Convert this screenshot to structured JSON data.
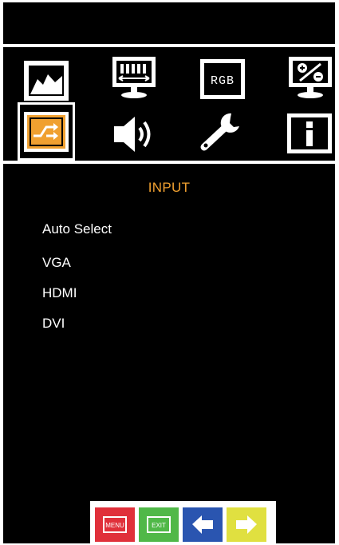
{
  "panel": {
    "title": "INPUT"
  },
  "options": [
    {
      "label": "Auto Select"
    },
    {
      "label": "VGA"
    },
    {
      "label": "HDMI"
    },
    {
      "label": "DVI"
    }
  ],
  "menu_icons": [
    {
      "name": "picture-icon"
    },
    {
      "name": "display-adjust-icon"
    },
    {
      "name": "rgb-icon",
      "label": "RGB"
    },
    {
      "name": "ratio-icon"
    },
    {
      "name": "input-source-icon",
      "selected": true
    },
    {
      "name": "audio-icon"
    },
    {
      "name": "settings-wrench-icon"
    },
    {
      "name": "info-icon"
    }
  ],
  "buttons": [
    {
      "name": "menu-button",
      "label": "MENU",
      "color": "#e0303a"
    },
    {
      "name": "exit-button",
      "label": "EXIT",
      "color": "#50b848"
    },
    {
      "name": "left-button",
      "color": "#2a55b0"
    },
    {
      "name": "right-button",
      "color": "#e0e040"
    }
  ],
  "colors": {
    "accent": "#f0a030",
    "background": "#000000",
    "text": "#ffffff"
  }
}
